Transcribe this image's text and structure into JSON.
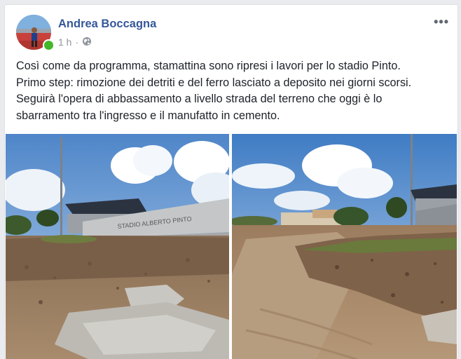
{
  "post": {
    "author": "Andrea Boccagna",
    "timestamp": "1 h",
    "separator": "·",
    "audience_icon": "globe-icon",
    "more_icon": "more-dots-icon",
    "more_label": "•••",
    "body": [
      "Così come da programma, stamattina sono ripresi i lavori per lo stadio Pinto.",
      "Primo step: rimozione dei detriti e del ferro lasciato a deposito nei giorni scorsi.",
      "Seguirà l'opera di abbassamento a livello strada del terreno che oggi è lo",
      "sbarramento tra l'ingresso e il manufatto in cemento."
    ],
    "photo_left": {
      "wall_text": "STADIO ALBERTO PINTO"
    },
    "colors": {
      "author": "#365899",
      "online": "#42b72a",
      "meta": "#90949c"
    }
  }
}
